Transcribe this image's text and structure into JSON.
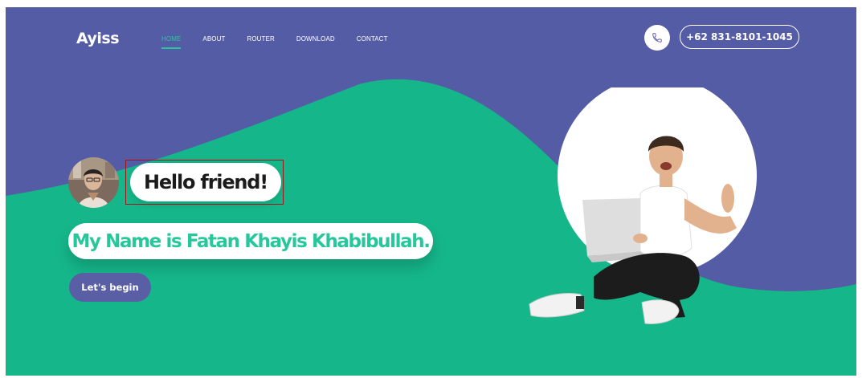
{
  "navbar": {
    "brand": "Ayiss",
    "links": [
      {
        "label": "HOME",
        "active": true
      },
      {
        "label": "ABOUT",
        "active": false
      },
      {
        "label": "ROUTER",
        "active": false
      },
      {
        "label": "DOWNLOAD",
        "active": false
      },
      {
        "label": "CONTACT",
        "active": false
      }
    ],
    "phone_icon": "phone-icon",
    "phone_number": "+62 831-8101-1045"
  },
  "hero": {
    "greeting": "Hello friend!",
    "name_line": "My Name is Fatan Khayis Khabibullah.",
    "cta_label": "Let's begin",
    "avatar_icon": "avatar-photo",
    "illustration": "person-with-laptop-illustration"
  },
  "colors": {
    "primary_purple": "#5a5ea5",
    "accent_green": "#15b78a",
    "text_green": "#27c79c",
    "highlight_border": "#a0141e"
  }
}
